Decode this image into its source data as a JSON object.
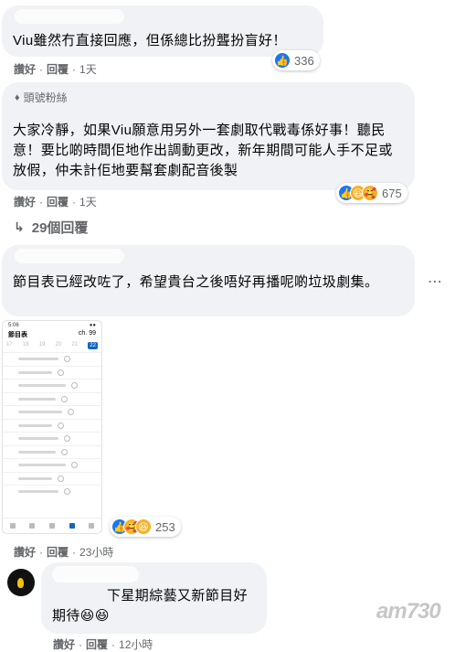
{
  "comments": [
    {
      "text": "Viu雖然冇直接回應，但係總比扮聾扮盲好！",
      "actions": {
        "like": "讚好",
        "reply": "回覆",
        "time": "1天"
      },
      "reactions": {
        "count": "336",
        "icons": [
          "like-icon"
        ]
      }
    },
    {
      "badge": "頭號粉絲",
      "text": "大家冷靜，如果Viu願意用另外一套劇取代戰毒係好事！聽民意！要比啲時間佢地作出調動更改，新年期間可能人手不足或放假，仲未計佢地要幫套劇配音後製",
      "actions": {
        "like": "讚好",
        "reply": "回覆",
        "time": "1天"
      },
      "reactions": {
        "count": "675",
        "icons": [
          "like-icon",
          "haha-icon",
          "care-icon"
        ]
      },
      "replies_label": "29個回覆"
    },
    {
      "text": "節目表已經改咗了，希望貴台之後唔好再播呢啲垃圾劇集。",
      "actions": {
        "like": "讚好",
        "reply": "回覆",
        "time": "23小時"
      },
      "reactions": {
        "count": "253",
        "icons": [
          "like-icon",
          "care-icon",
          "haha-icon"
        ]
      },
      "screenshot": {
        "status_time": "5:06",
        "title": "節目表",
        "channel": "ch. 99",
        "dates": [
          "17",
          "18",
          "19",
          "20",
          "21",
          "22"
        ],
        "selected_date": "22"
      }
    },
    {
      "text": "下星期綜藝又新節目好期待😆😆",
      "actions": {
        "like": "讚好",
        "reply": "回覆",
        "time": "12小時"
      }
    }
  ],
  "watermark": "am730"
}
